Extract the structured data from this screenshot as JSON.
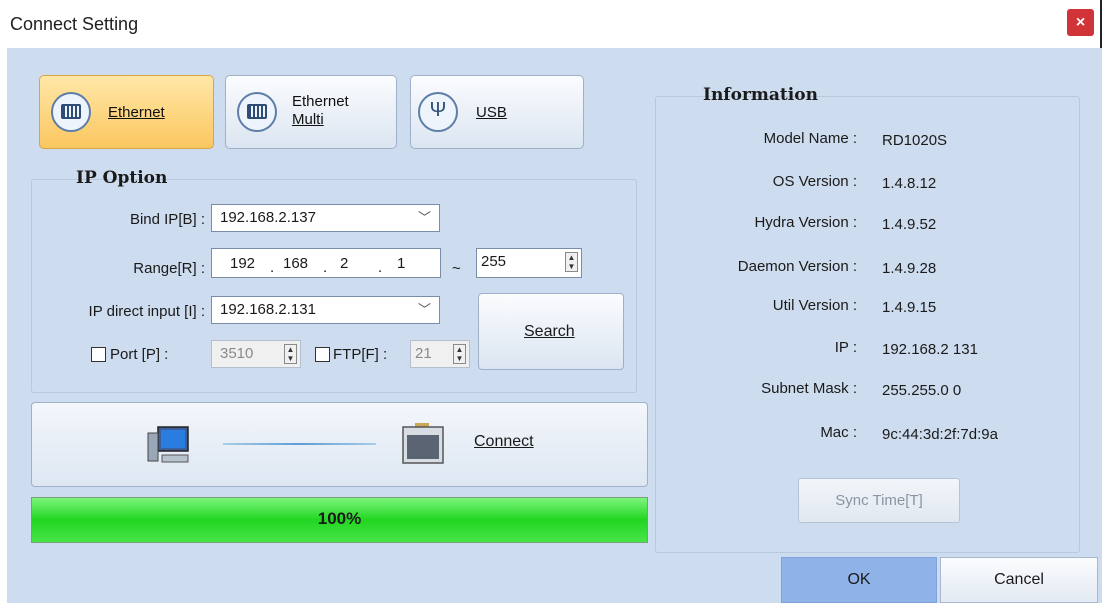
{
  "window": {
    "title": "Connect Setting",
    "close_glyph": "×"
  },
  "modes": {
    "ethernet": {
      "label": "Ethernet",
      "icon": "ethernet-port-icon",
      "active": true
    },
    "ethernet_multi": {
      "line1": "Ethernet",
      "line2": "Multi",
      "icon": "ethernet-port-icon"
    },
    "usb": {
      "label": "USB",
      "icon": "usb-icon"
    }
  },
  "ip_option": {
    "title": "IP Option",
    "bind_ip": {
      "label": "Bind IP[B] :",
      "value": "192.168.2.137"
    },
    "range": {
      "label": "Range[R] :",
      "octets": [
        "192",
        "168",
        "2",
        "1"
      ],
      "tilde": "~",
      "end": "255"
    },
    "direct_input": {
      "label": "IP direct input [I] :",
      "value": "192.168.2.131"
    },
    "port": {
      "label": "Port [P] :",
      "value": "3510",
      "checked": false
    },
    "ftp": {
      "label": "FTP[F] :",
      "value": "21",
      "checked": false
    },
    "search_label": "Search"
  },
  "connect": {
    "label": "Connect",
    "pc_icon": "computer-icon",
    "device_icon": "device-icon"
  },
  "progress": {
    "text": "100%",
    "fraction": 1.0,
    "color": "#22d622"
  },
  "information": {
    "title": "Information",
    "rows": [
      {
        "label": "Model Name :",
        "value": "RD1020S"
      },
      {
        "label": "OS Version :",
        "value": "1.4.8.12"
      },
      {
        "label": "Hydra Version :",
        "value": "1.4.9.52"
      },
      {
        "label": "Daemon Version :",
        "value": "1.4.9.28"
      },
      {
        "label": "Util Version :",
        "value": "1.4.9.15"
      },
      {
        "label": "IP :",
        "value": "192.168.2 131"
      },
      {
        "label": "Subnet Mask :",
        "value": "255.255.0 0"
      },
      {
        "label": "Mac :",
        "value": "9c:44:3d:2f:7d:9a"
      }
    ],
    "sync_time_label": "Sync Time[T]"
  },
  "buttons": {
    "ok": "OK",
    "cancel": "Cancel"
  },
  "colors": {
    "accent_active": "#fbc760",
    "close_red": "#d13438",
    "ok_blue": "#8fb3e8"
  }
}
